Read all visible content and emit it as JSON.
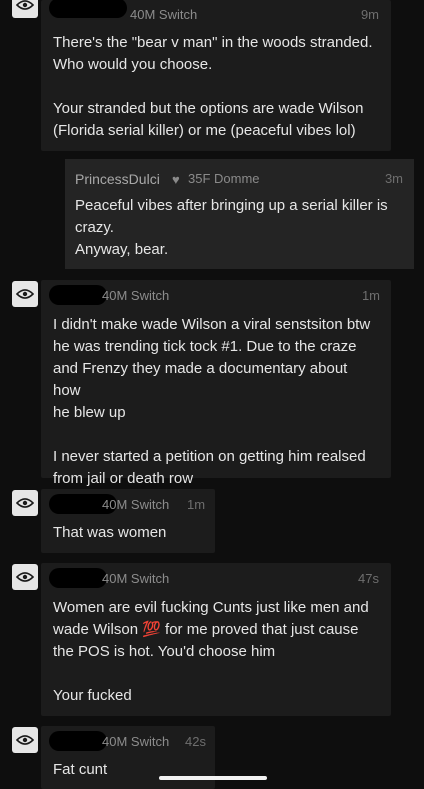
{
  "messages": [
    {
      "role": "40M Switch",
      "time": "9m",
      "lines": [
        "There's the \"bear v man\" in the woods stranded.",
        "Who would you choose."
      ],
      "lines2": [
        "Your stranded but the options are wade Wilson",
        "(Florida serial killer) or me (peaceful vibes lol)"
      ]
    },
    {
      "role": "40M Switch",
      "time": "1m",
      "lines": [
        "I didn't make wade Wilson a viral senstsiton btw",
        "he was trending tick tock #1. Due to the craze",
        "and Frenzy they made a documentary about how",
        "he blew up"
      ],
      "lines2": [
        "I never started a petition on getting him realsed",
        "from jail or death row"
      ]
    },
    {
      "role": "40M Switch",
      "time": "1m",
      "lines": [
        "That was women"
      ]
    },
    {
      "role": "40M Switch",
      "time": "47s",
      "lines": [
        "Women are evil fucking Cunts just like men and",
        "wade Wilson 💯 for me proved that just cause",
        "the POS is hot. You'd choose him"
      ],
      "lines2": [
        "Your fucked"
      ]
    },
    {
      "role": "40M Switch",
      "time": "42s",
      "lines": [
        "Fat cunt"
      ]
    }
  ],
  "reply": {
    "name": "PrincessDulci",
    "heart": "♥",
    "role": "35F Domme",
    "time": "3m",
    "lines": [
      "Peaceful vibes after bringing up a serial killer is",
      "crazy.",
      "Anyway, bear."
    ]
  }
}
